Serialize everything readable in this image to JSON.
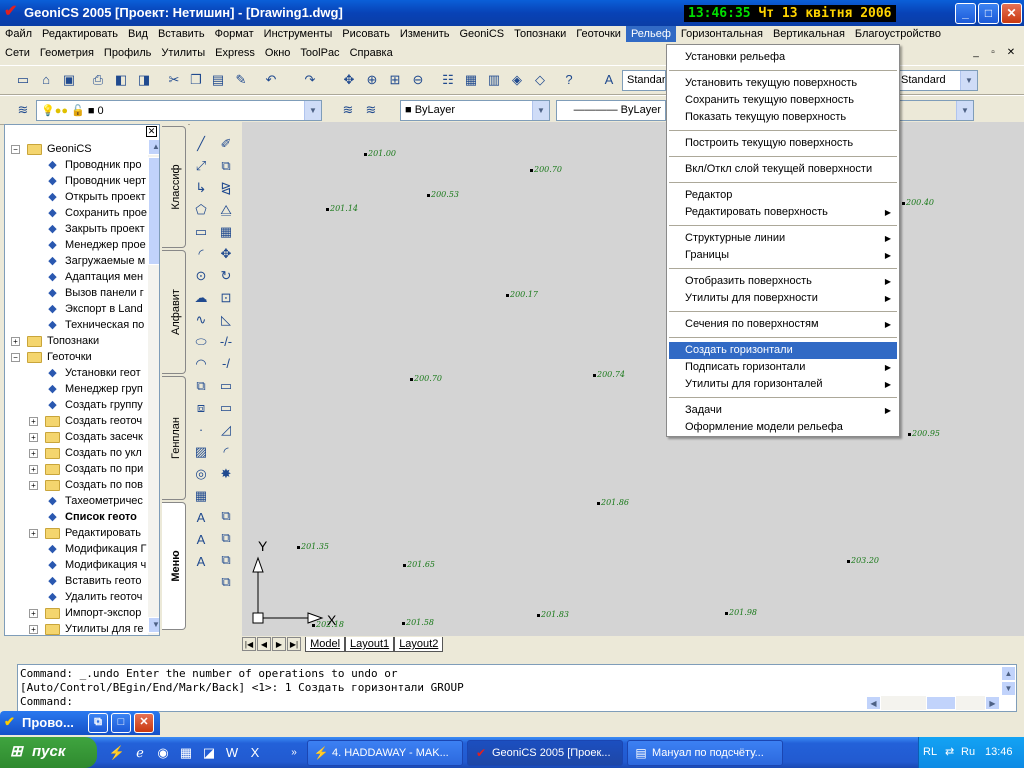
{
  "window": {
    "title": "GeoniCS 2005 [Проект: Нетишин] - [Drawing1.dwg]",
    "clock_time": "13:46:35",
    "clock_date": "Чт 13 квітня 2006",
    "minimize": "_",
    "maximize": "□",
    "close": "✕"
  },
  "menubar1": [
    "Файл",
    "Редактировать",
    "Вид",
    "Вставить",
    "Формат",
    "Инструменты",
    "Рисовать",
    "Изменить",
    "GeoniCS",
    "Топознаки",
    "Геоточки",
    "Рельеф",
    "Горизонтальная",
    "Вертикальная",
    "Благоустройство"
  ],
  "menubar2": [
    "Сети",
    "Геометрия",
    "Профиль",
    "Утилиты",
    "Express",
    "Окно",
    "ToolPac",
    "Справка"
  ],
  "toolbar": {
    "text_style": "Standard",
    "dim_style": "Standard",
    "layer": "0",
    "color": "ByLayer",
    "linetype": "ByLayer"
  },
  "tree": [
    {
      "label": "GeoniCS",
      "level": 0,
      "exp": "−",
      "folder": true
    },
    {
      "label": "Проводник про",
      "level": 2
    },
    {
      "label": "Проводник черт",
      "level": 2
    },
    {
      "label": "Открыть проект",
      "level": 2
    },
    {
      "label": "Сохранить прое",
      "level": 2
    },
    {
      "label": "Закрыть проект",
      "level": 2
    },
    {
      "label": "Менеджер прое",
      "level": 2
    },
    {
      "label": "Загружаемые м",
      "level": 2
    },
    {
      "label": "Адаптация мен",
      "level": 2
    },
    {
      "label": "Вызов панели г",
      "level": 2
    },
    {
      "label": "Экспорт в Land",
      "level": 2
    },
    {
      "label": "Техническая по",
      "level": 2
    },
    {
      "label": "Топознаки",
      "level": 0,
      "exp": "+",
      "folder": true
    },
    {
      "label": "Геоточки",
      "level": 0,
      "exp": "−",
      "folder": true
    },
    {
      "label": "Установки геот",
      "level": 2
    },
    {
      "label": "Менеджер груп",
      "level": 2
    },
    {
      "label": "Создать группу",
      "level": 2
    },
    {
      "label": "Создать геоточ",
      "level": 1,
      "exp": "+",
      "folder": true
    },
    {
      "label": "Создать засечк",
      "level": 1,
      "exp": "+",
      "folder": true
    },
    {
      "label": "Создать по укл",
      "level": 1,
      "exp": "+",
      "folder": true
    },
    {
      "label": "Создать по при",
      "level": 1,
      "exp": "+",
      "folder": true
    },
    {
      "label": "Создать по пов",
      "level": 1,
      "exp": "+",
      "folder": true
    },
    {
      "label": "Тахеометричес",
      "level": 2
    },
    {
      "label": "Список геото",
      "level": 2,
      "bold": true
    },
    {
      "label": "Редактировать",
      "level": 1,
      "exp": "+",
      "folder": true
    },
    {
      "label": "Модификация Г",
      "level": 2
    },
    {
      "label": "Модификация ч",
      "level": 2
    },
    {
      "label": "Вставить геото",
      "level": 2
    },
    {
      "label": "Удалить геоточ",
      "level": 2
    },
    {
      "label": "Импорт-экспор",
      "level": 1,
      "exp": "+",
      "folder": true
    },
    {
      "label": "Утилиты для ге",
      "level": 1,
      "exp": "+",
      "folder": true
    }
  ],
  "side_tabs": [
    "Классиф",
    "Алфавит",
    "Генплан",
    "Меню"
  ],
  "canvas": {
    "points": [
      {
        "label": "201.00"
      },
      {
        "label": "200.70"
      },
      {
        "label": "200.53"
      },
      {
        "label": "201.14"
      },
      {
        "label": "200.40"
      },
      {
        "label": "200.17"
      },
      {
        "label": "200.70"
      },
      {
        "label": "200.74"
      },
      {
        "label": "200.95"
      },
      {
        "label": "201.86"
      },
      {
        "label": "201.35"
      },
      {
        "label": "201.65"
      },
      {
        "label": "203.20"
      },
      {
        "label": "201.58"
      },
      {
        "label": "201.83"
      },
      {
        "label": "201.98"
      },
      {
        "label": "202.18"
      }
    ],
    "ucs_y": "Y",
    "ucs_x": "X"
  },
  "layout_tabs": [
    "Model",
    "Layout1",
    "Layout2"
  ],
  "command_lines": [
    "Command: _.undo Enter the number of operations to undo or",
    "[Auto/Control/BEgin/End/Mark/Back] <1>: 1 Создать горизонтали GROUP",
    "Command:"
  ],
  "mini_window": {
    "title": "Прово..."
  },
  "dropdown": [
    {
      "label": "Установки рельефа"
    },
    {
      "sep": true
    },
    {
      "label": "Установить текущую поверхность"
    },
    {
      "label": "Сохранить текущую поверхность"
    },
    {
      "label": "Показать текущую поверхность"
    },
    {
      "sep": true
    },
    {
      "label": "Построить текущую поверхность"
    },
    {
      "sep": true
    },
    {
      "label": "Вкл/Откл слой текущей поверхности"
    },
    {
      "sep": true
    },
    {
      "label": "Редактор"
    },
    {
      "label": "Редактировать поверхность",
      "sub": true
    },
    {
      "sep": true
    },
    {
      "label": "Структурные линии",
      "sub": true
    },
    {
      "label": "Границы",
      "sub": true
    },
    {
      "sep": true
    },
    {
      "label": "Отобразить поверхность",
      "sub": true
    },
    {
      "label": "Утилиты для поверхности",
      "sub": true
    },
    {
      "sep": true
    },
    {
      "label": "Сечения по поверхностям",
      "sub": true
    },
    {
      "sep": true
    },
    {
      "label": "Создать горизонтали",
      "selected": true
    },
    {
      "label": "Подписать горизонтали",
      "sub": true
    },
    {
      "label": "Утилиты для горизонталей",
      "sub": true
    },
    {
      "sep": true
    },
    {
      "label": "Задачи",
      "sub": true
    },
    {
      "label": "Оформление модели рельефа"
    }
  ],
  "taskbar": {
    "start": "пуск",
    "tasks": [
      {
        "label": "4. HADDAWAY - MAK..."
      },
      {
        "label": "GeoniCS 2005 [Проек..."
      },
      {
        "label": "Мануал по подсчёту..."
      }
    ],
    "lang": "RL",
    "input_lang": "Ru",
    "time": "13:46"
  },
  "colors": {
    "accent": "#316ac5",
    "titlebar": "#0a5fd8",
    "canvas_bg": "#d4d4d4",
    "point_label": "#1a7a1a"
  }
}
